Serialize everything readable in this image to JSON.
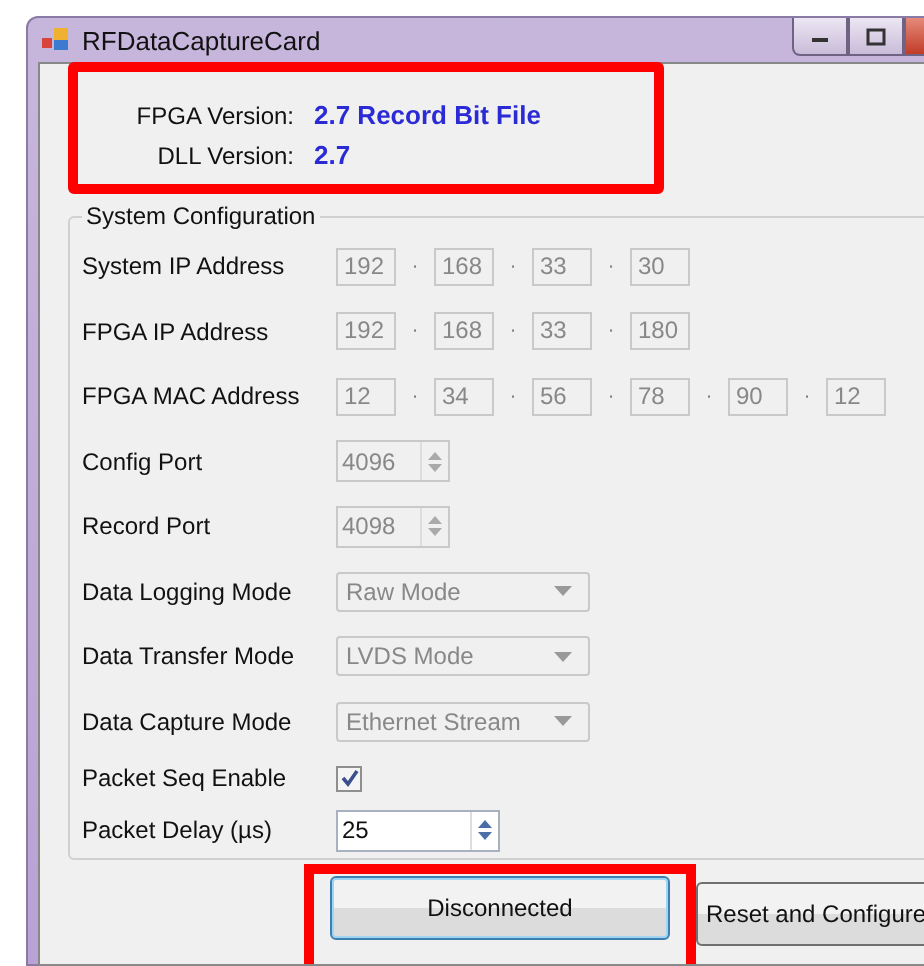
{
  "window": {
    "title": "RFDataCaptureCard"
  },
  "versions": {
    "highlighted": true,
    "items": [
      {
        "label": "FPGA Version:",
        "value": "2.7 Record Bit File"
      },
      {
        "label": "DLL Version:",
        "value": "2.7"
      }
    ]
  },
  "group": {
    "title": "System Configuration",
    "rows": [
      {
        "kind": "octets",
        "label": "System IP Address",
        "separator": "·",
        "octets": [
          "192",
          "168",
          "33",
          "30"
        ]
      },
      {
        "kind": "octets",
        "label": "FPGA IP Address",
        "separator": "·",
        "octets": [
          "192",
          "168",
          "33",
          "180"
        ]
      },
      {
        "kind": "octets",
        "label": "FPGA MAC Address",
        "separator": "·",
        "octets": [
          "12",
          "34",
          "56",
          "78",
          "90",
          "12"
        ]
      },
      {
        "kind": "spinner",
        "label": "Config Port",
        "value": "4096",
        "disabled": true
      },
      {
        "kind": "spinner",
        "label": "Record Port",
        "value": "4098",
        "disabled": true
      },
      {
        "kind": "dropdown",
        "label": "Data Logging Mode",
        "value": "Raw Mode",
        "disabled": true
      },
      {
        "kind": "dropdown",
        "label": "Data Transfer Mode",
        "value": "LVDS Mode",
        "disabled": true
      },
      {
        "kind": "dropdown",
        "label": "Data Capture Mode",
        "value": "Ethernet Stream",
        "disabled": true
      },
      {
        "kind": "checkbox",
        "label": "Packet Seq Enable",
        "checked": true
      },
      {
        "kind": "spinner",
        "label": "Packet Delay (µs)",
        "value": "25",
        "disabled": false
      }
    ]
  },
  "buttons": [
    {
      "label": "Disconnected",
      "focused": true,
      "highlighted": true
    },
    {
      "label": "Reset and Configure",
      "focused": false,
      "highlighted": false
    }
  ]
}
